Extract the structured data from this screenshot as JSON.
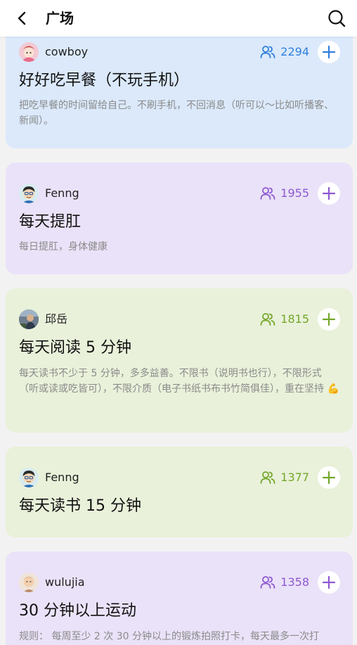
{
  "header": {
    "title": "广场"
  },
  "cards": [
    {
      "username": "cowboy",
      "members": "2294",
      "title": "好好吃早餐（不玩手机）",
      "description": "把吃早餐的时间留给自己。不刷手机，不回消息（听可以～比如听播客、新闻）。",
      "bg": "#dbe9fb",
      "accent": "#2f7fdc"
    },
    {
      "username": "Fenng",
      "members": "1955",
      "title": "每天提肛",
      "description": "每日提肛，身体健康",
      "bg": "#eae2f8",
      "accent": "#8e58d2"
    },
    {
      "username": "邱岳",
      "members": "1815",
      "title": "每天阅读 5 分钟",
      "description": "每天读书不少于 5 分钟，多多益善。不限书（说明书也行），不限形式（听或读或吃皆可），不限介质（电子书纸书布书竹简俱佳），重在坚持 💪",
      "bg": "#e9f1da",
      "accent": "#74a72a"
    },
    {
      "username": "Fenng",
      "members": "1377",
      "title": "每天读书 15 分钟",
      "description": "",
      "bg": "#e9f1da",
      "accent": "#74a72a"
    },
    {
      "username": "wulujia",
      "members": "1358",
      "title": "30 分钟以上运动",
      "description": "规则： 每周至少 2 次 30 分钟以上的锻炼拍照打卡，每天最多一次打",
      "bg": "#eae2f8",
      "accent": "#8e58d2"
    }
  ]
}
